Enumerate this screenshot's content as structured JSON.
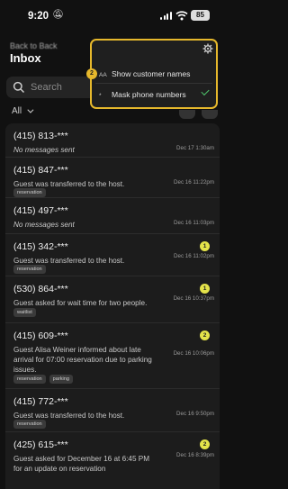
{
  "status_bar": {
    "time": "9:20",
    "battery": "85"
  },
  "header": {
    "back_label": "Back to Back",
    "title": "Inbox"
  },
  "search": {
    "placeholder": "Search"
  },
  "filter": {
    "label": "All"
  },
  "settings_popup": {
    "step_number": "2",
    "options": [
      {
        "icon": "AA",
        "label": "Show customer names",
        "checked": false
      },
      {
        "icon": "*",
        "label": "Mask phone numbers",
        "checked": true
      }
    ]
  },
  "conversations": [
    {
      "phone": "(415) 813-***",
      "message": "No messages sent",
      "italic": true,
      "timestamp": "Dec 17 1:30am",
      "unread": "",
      "tags": []
    },
    {
      "phone": "(415) 847-***",
      "message": "Guest was transferred to the host.",
      "italic": false,
      "timestamp": "Dec 16 11:22pm",
      "unread": "",
      "tags": [
        "reservation"
      ]
    },
    {
      "phone": "(415) 497-***",
      "message": "No messages sent",
      "italic": true,
      "timestamp": "Dec 16 11:03pm",
      "unread": "",
      "tags": []
    },
    {
      "phone": "(415) 342-***",
      "message": "Guest was transferred to the host.",
      "italic": false,
      "timestamp": "Dec 16 11:02pm",
      "unread": "1",
      "tags": [
        "reservation"
      ]
    },
    {
      "phone": "(530) 864-***",
      "message": "Guest asked for wait time for two people.",
      "italic": false,
      "timestamp": "Dec 16 10:37pm",
      "unread": "1",
      "tags": [
        "waitlist"
      ]
    },
    {
      "phone": "(415) 609-***",
      "message": "Guest Alisa Weiner informed about late arrival for 07:00 reservation due to parking issues.",
      "italic": false,
      "timestamp": "Dec 16 10:06pm",
      "unread": "2",
      "tags": [
        "reservation",
        "parking"
      ]
    },
    {
      "phone": "(415) 772-***",
      "message": "Guest was transferred to the host.",
      "italic": false,
      "timestamp": "Dec 16 9:50pm",
      "unread": "",
      "tags": [
        "reservation"
      ]
    },
    {
      "phone": "(425) 615-***",
      "message": "Guest asked for December 16 at 6:45 PM for an update on reservation",
      "italic": false,
      "timestamp": "Dec 16 8:39pm",
      "unread": "2",
      "tags": []
    }
  ]
}
